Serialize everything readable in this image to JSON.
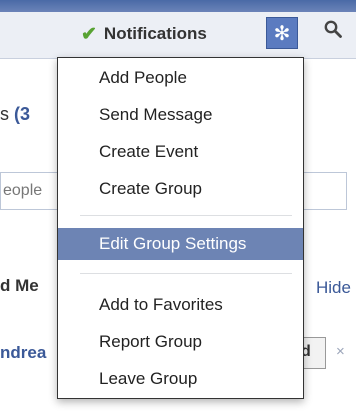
{
  "topbar": {
    "notifications_label": "Notifications",
    "check_glyph": "✔",
    "gear_glyph": "✻",
    "search_glyph": "🔍"
  },
  "background": {
    "members_prefix": "s",
    "members_count": "(3",
    "slash": "/",
    "input_value": "eople",
    "section_heading": "d Me",
    "hide_label": "Hide",
    "member_name": "ndrea",
    "member_button": "d",
    "close_glyph": "×"
  },
  "menu": {
    "items": [
      {
        "label": "Add People"
      },
      {
        "label": "Send Message"
      },
      {
        "label": "Create Event"
      },
      {
        "label": "Create Group"
      },
      {
        "label": "Edit Group Settings",
        "selected": true
      },
      {
        "label": "Add to Favorites"
      },
      {
        "label": "Report Group"
      },
      {
        "label": "Leave Group"
      }
    ]
  },
  "colors": {
    "accent": "#3b5998",
    "highlight": "#6d84b4",
    "check": "#58a333"
  }
}
